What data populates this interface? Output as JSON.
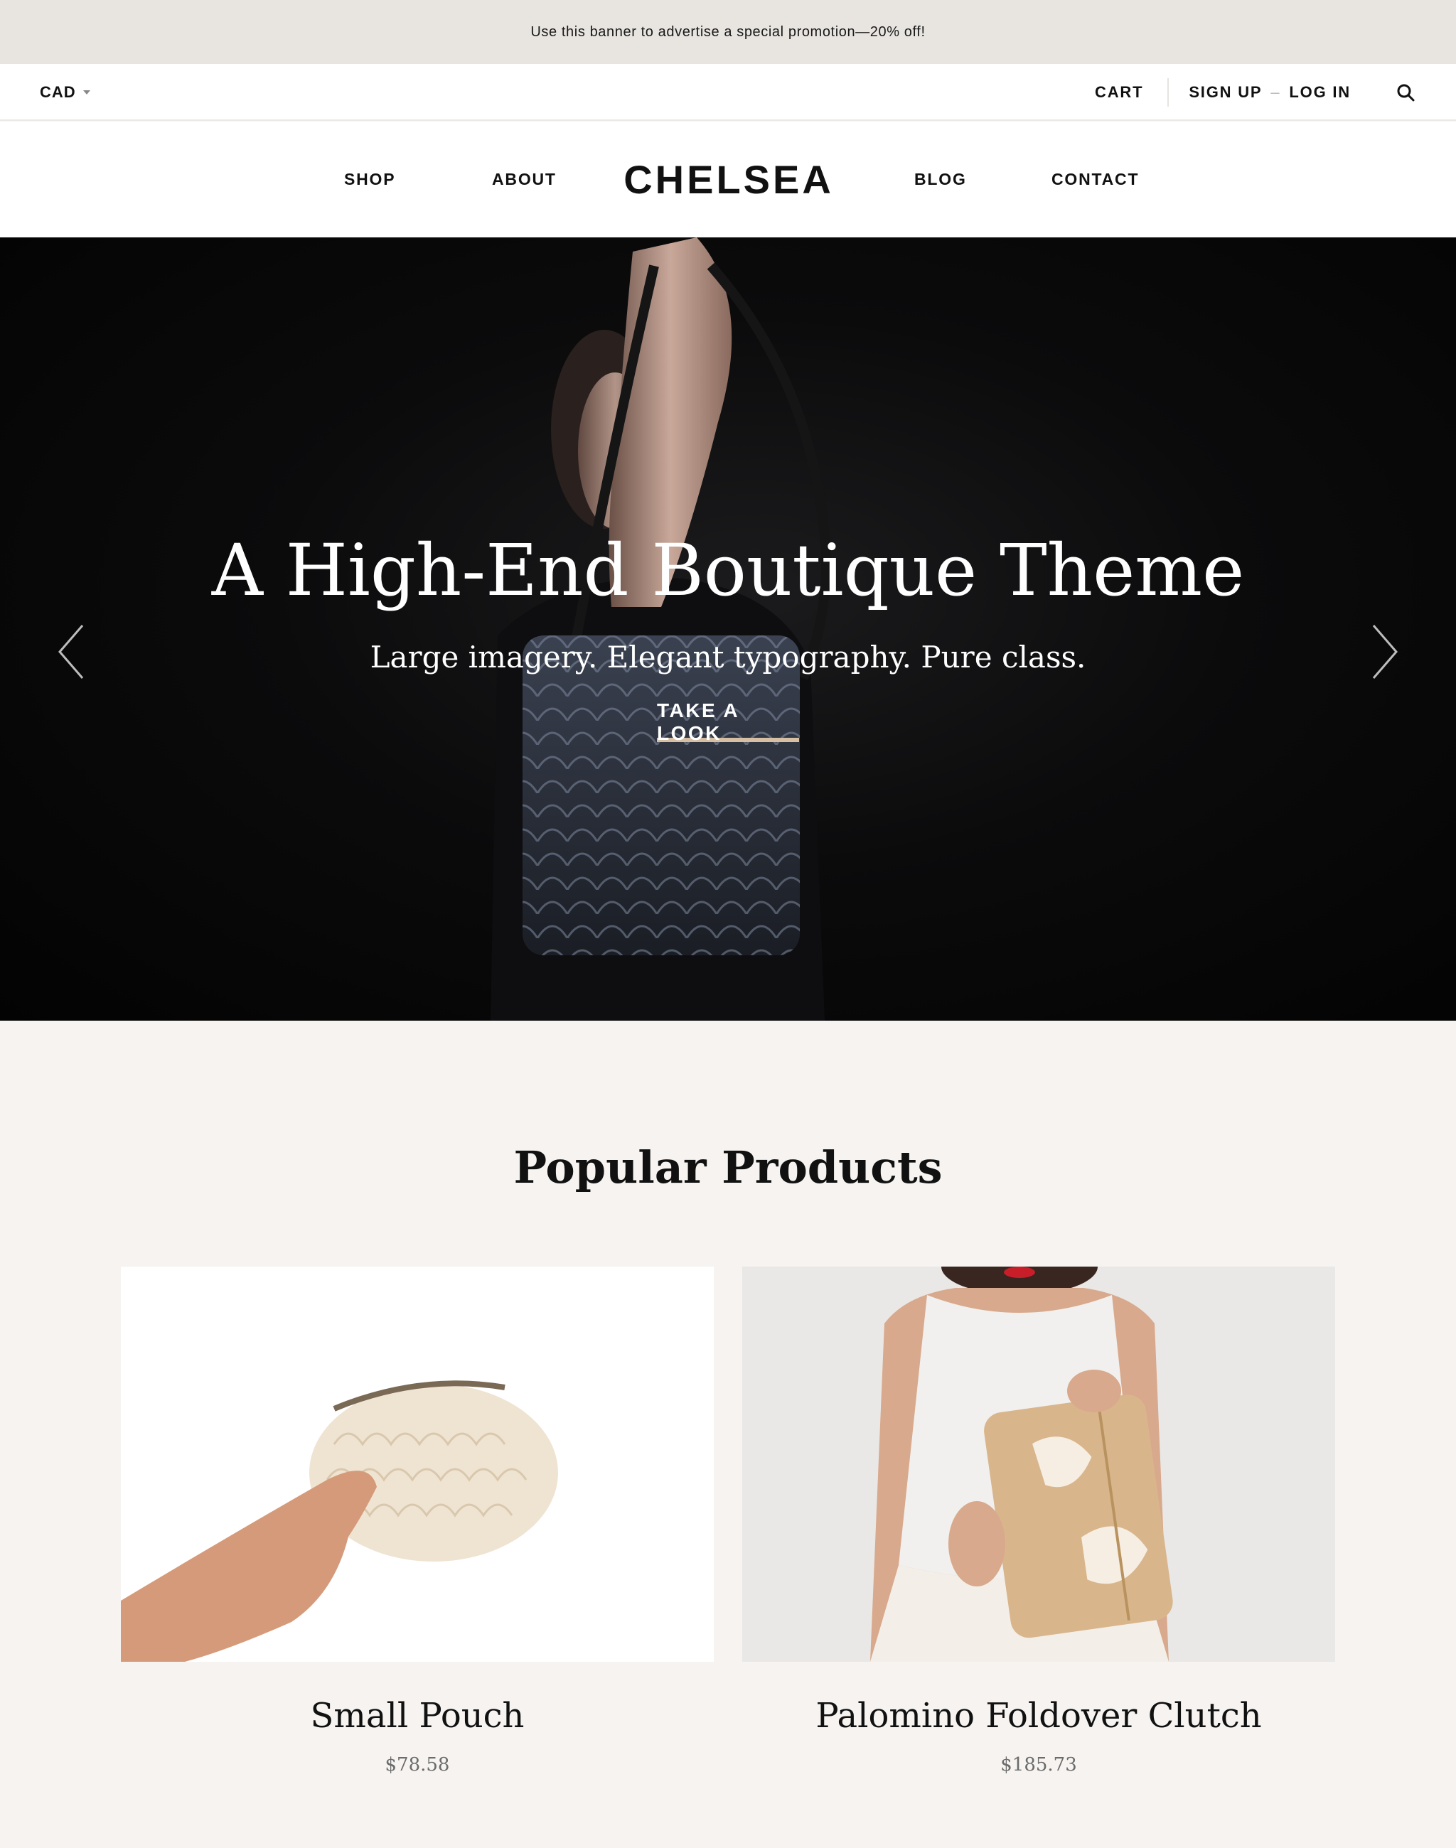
{
  "promo": {
    "text": "Use this banner to advertise a special promotion—20% off!"
  },
  "utility": {
    "currency": "CAD",
    "cart": "CART",
    "sign_up": "SIGN UP",
    "separator": "–",
    "log_in": "LOG IN"
  },
  "nav": {
    "shop": "SHOP",
    "about": "ABOUT",
    "logo": "CHELSEA",
    "blog": "BLOG",
    "contact": "CONTACT"
  },
  "hero": {
    "title": "A High-End Boutique Theme",
    "subtitle": "Large imagery. Elegant typography. Pure class.",
    "cta": "TAKE A LOOK"
  },
  "popular": {
    "title": "Popular Products",
    "products": [
      {
        "name": "Small Pouch",
        "price": "$78.58"
      },
      {
        "name": "Palomino Foldover Clutch",
        "price": "$185.73"
      }
    ]
  },
  "colors": {
    "accent_underline": "#d6bfa3",
    "promo_bg": "#e8e5e1",
    "page_bg": "#f6f3f1",
    "hero_bg": "#050505"
  },
  "icons": [
    "caret-down-icon",
    "search-icon",
    "chevron-left-icon",
    "chevron-right-icon"
  ]
}
